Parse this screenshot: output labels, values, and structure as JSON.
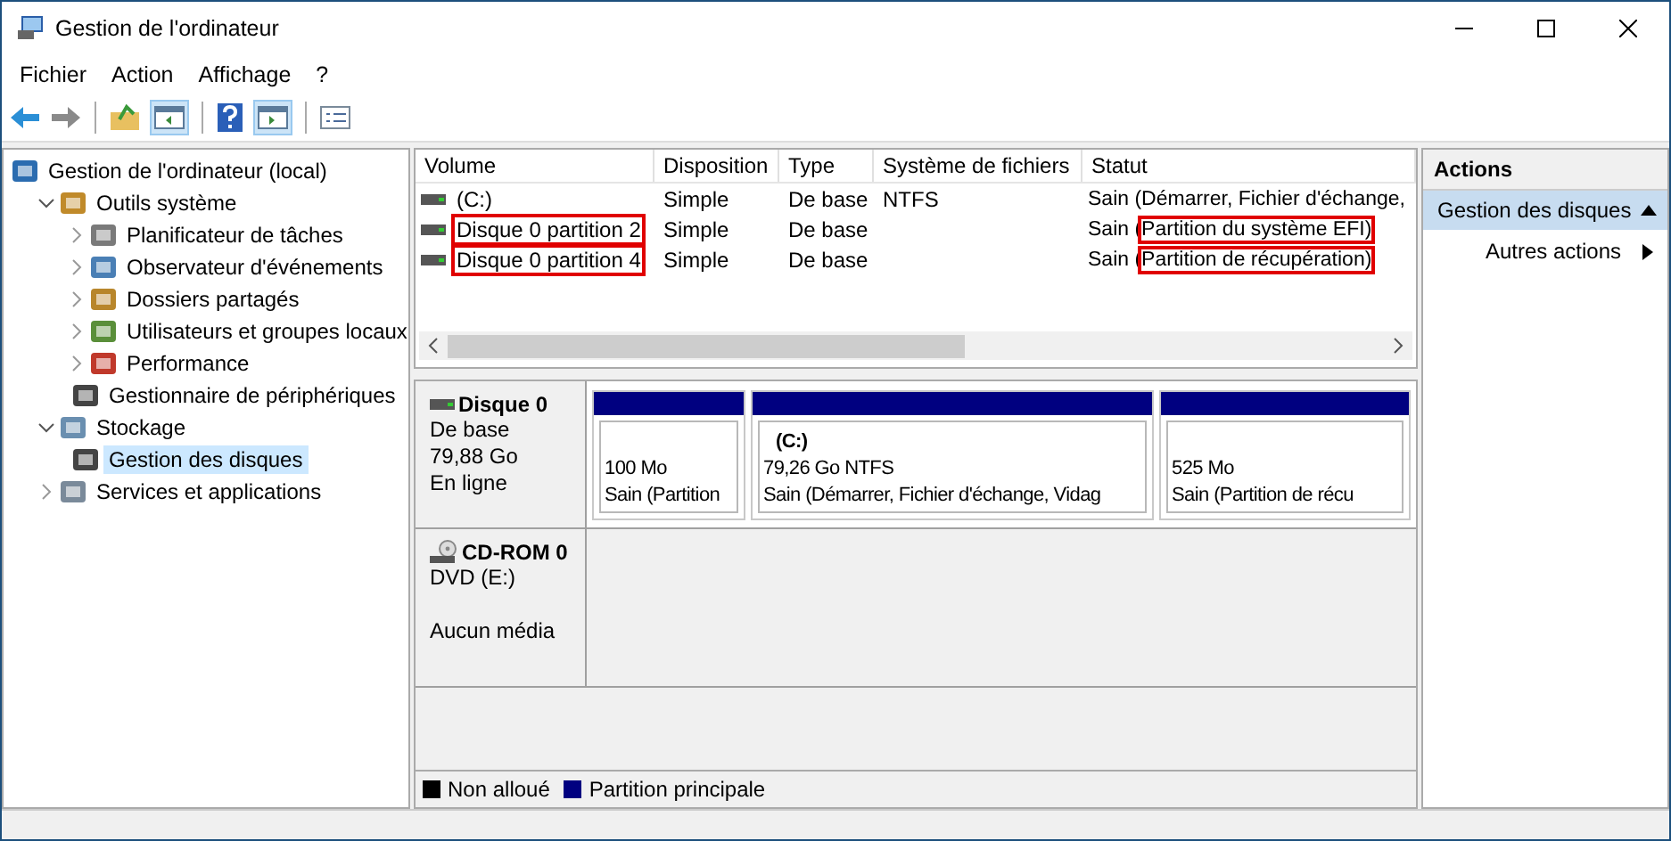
{
  "window": {
    "title": "Gestion de l'ordinateur"
  },
  "menu": [
    "Fichier",
    "Action",
    "Affichage",
    "?"
  ],
  "tree": [
    {
      "label": "Gestion de l'ordinateur (local)",
      "selected": false,
      "children": [
        {
          "label": "Outils système",
          "expanded": true,
          "selected": false,
          "children": [
            {
              "label": "Planificateur de tâches",
              "expanded": false,
              "selected": false
            },
            {
              "label": "Observateur d'événements",
              "expanded": false,
              "selected": false
            },
            {
              "label": "Dossiers partagés",
              "expanded": false,
              "selected": false
            },
            {
              "label": "Utilisateurs et groupes locaux",
              "expanded": false,
              "selected": false
            },
            {
              "label": "Performance",
              "expanded": false,
              "selected": false
            },
            {
              "label": "Gestionnaire de périphériques",
              "selected": false
            }
          ]
        },
        {
          "label": "Stockage",
          "expanded": true,
          "selected": false,
          "children": [
            {
              "label": "Gestion des disques",
              "selected": true
            }
          ]
        },
        {
          "label": "Services et applications",
          "expanded": false,
          "selected": false
        }
      ]
    }
  ],
  "table": {
    "columns": [
      "Volume",
      "Disposition",
      "Type",
      "Système de fichiers",
      "Statut"
    ],
    "rows": [
      {
        "volume": {
          "text": "(C:)",
          "highlighted": false
        },
        "disposition": "Simple",
        "type": "De base",
        "filesystem": "NTFS",
        "status": [
          {
            "text": "Sain (Démarrer, Fichier d'échange,",
            "highlighted": false
          }
        ]
      },
      {
        "volume": {
          "text": "Disque 0 partition 2",
          "highlighted": true
        },
        "disposition": "Simple",
        "type": "De base",
        "status": [
          {
            "text": "Sain (",
            "highlighted": false
          },
          {
            "text": "Partition du système EFI)",
            "highlighted": true
          }
        ]
      },
      {
        "volume": {
          "text": "Disque 0 partition 4",
          "highlighted": true
        },
        "disposition": "Simple",
        "type": "De base",
        "status": [
          {
            "text": "Sain (",
            "highlighted": false
          },
          {
            "text": "Partition de récupération)",
            "highlighted": true
          }
        ]
      }
    ]
  },
  "disks": [
    {
      "kind": "disk",
      "name": "Disque 0",
      "lines": [
        "De base",
        "79,88 Go",
        "En ligne"
      ],
      "partitions": [
        {
          "color": "#000080",
          "size": "100 Mo",
          "status": "Sain (Partition"
        },
        {
          "color": "#000080",
          "label": "(C:)",
          "size": "79,26 Go NTFS",
          "status": "Sain (Démarrer, Fichier d'échange, Vidag"
        },
        {
          "color": "#000080",
          "size": "525 Mo",
          "status": "Sain (Partition de récu"
        }
      ]
    },
    {
      "kind": "cdrom",
      "name": "CD-ROM 0",
      "lines": [
        "DVD (E:)"
      ],
      "media": "Aucun média"
    }
  ],
  "legend": [
    {
      "label": "Non alloué",
      "color": "#000000"
    },
    {
      "label": "Partition principale",
      "color": "#000080"
    }
  ],
  "actions": {
    "title": "Actions",
    "items": [
      {
        "kind": "section",
        "label": "Gestion des disques"
      },
      {
        "kind": "item",
        "label": "Autres actions"
      }
    ]
  }
}
